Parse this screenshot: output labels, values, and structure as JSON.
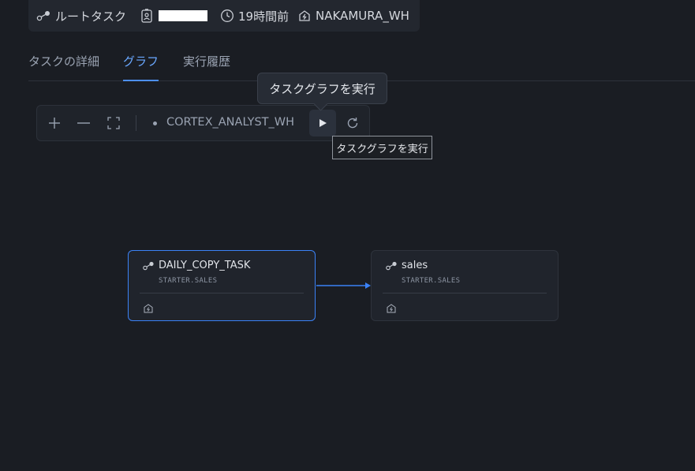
{
  "header": {
    "root_task_label": "ルートタスク",
    "time_label": "19時間前",
    "warehouse_label": "NAKAMURA_WH"
  },
  "tabs": [
    {
      "label": "タスクの詳細",
      "active": false
    },
    {
      "label": "グラフ",
      "active": true
    },
    {
      "label": "実行履歴",
      "active": false
    }
  ],
  "toolbar": {
    "warehouse_label": "CORTEX_ANALYST_WH"
  },
  "tooltips": {
    "run_graph": "タスクグラフを実行",
    "run_graph_native": "タスクグラフを実行"
  },
  "graph": {
    "nodes": [
      {
        "title": "DAILY_COPY_TASK",
        "subtitle": "STARTER.SALES",
        "selected": true
      },
      {
        "title": "sales",
        "subtitle": "STARTER.SALES",
        "selected": false
      }
    ]
  },
  "colors": {
    "accent": "#4d8ff0",
    "edge": "#3b82f6",
    "background": "#1a1d23"
  }
}
